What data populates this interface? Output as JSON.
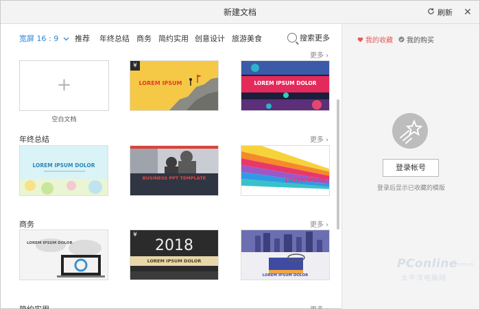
{
  "window": {
    "title": "新建文档"
  },
  "toolbar": {
    "refresh_label": "刷新",
    "close_symbol": "✕"
  },
  "nav": {
    "active": "宽屏 16 : 9",
    "items": [
      "推荐",
      "年终总结",
      "商务",
      "简约实用",
      "创意设计",
      "旅游美食"
    ],
    "search_label": "搜索更多"
  },
  "content": {
    "more_label": "更多",
    "blank_caption": "空白文档",
    "blank_symbol": "+",
    "sections": [
      "年终总结",
      "商务",
      "简约实用"
    ]
  },
  "templates": {
    "price_badge": "¥",
    "lorem_ipsum": "LOREM IPSUM",
    "lorem_dolor": "LOREM IPSUM DOLOR",
    "business_template": "BUSINESS PPT TEMPLATE",
    "year": "2018"
  },
  "sidebar": {
    "tab_favorites": "我的收藏",
    "tab_purchases": "我的购买",
    "login_button": "登录帐号",
    "login_hint": "登录后显示已收藏的模版"
  },
  "watermark": {
    "brand": "PConline",
    "cn": "太平洋电脑网",
    "domain": ".com.cn"
  }
}
